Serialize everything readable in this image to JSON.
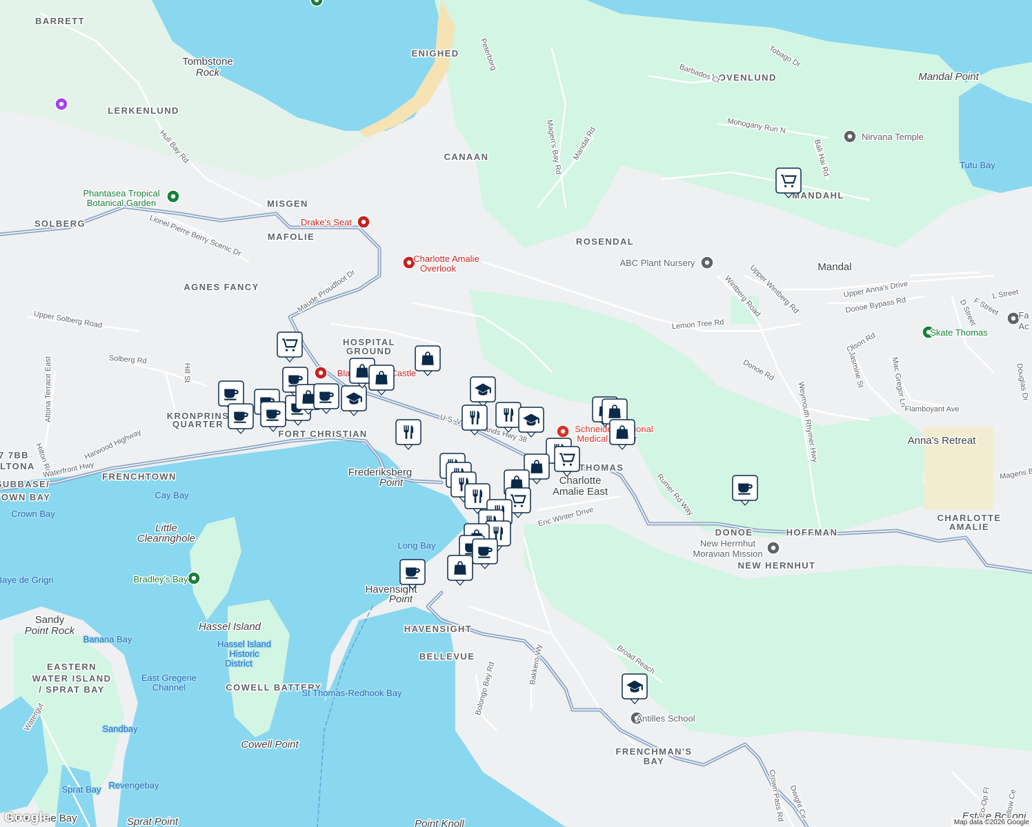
{
  "map": {
    "colors": {
      "land": "#eef0f2",
      "park": "#d3f5e3",
      "water": "#8ad7f0",
      "deep_water": "#5ec8ec",
      "beach": "#f5e3b3",
      "road": "#ffffff",
      "highway": "#8aa4c3",
      "marker": "#0b2a4a"
    },
    "labels": {
      "areas": [
        "BARRETT",
        "ENIGHED",
        "LOVENLUND",
        "LERKENLUND",
        "CANAAN",
        "MANDAHL",
        "MISGEN",
        "MAFOLIE",
        "SOLBERG",
        "ROSENDAL",
        "AGNES FANCY",
        "HOSPITAL",
        "GROUND",
        "KRONPRINS",
        "QUARTER",
        "FORT CHRISTIAN",
        "7 7BB",
        "ALTONA",
        "FRENCHTOWN",
        "SUBBASE/",
        "TOWN BAY",
        "THOMAS",
        "DONOE",
        "HOFFMAN",
        "NEW HERNHUT",
        "HAVENSIGHT",
        "BELLEVUE",
        "COWELL BATTERY",
        "EASTERN",
        "WATER ISLAND",
        "/ SPRAT BAY",
        "FRENCHMAN'S",
        "BAY",
        "CHARLOTTE",
        "AMALIE"
      ],
      "places": [
        "Tombstone",
        "Rock",
        "Mandal Point",
        "Mandal",
        "Anna's Retreat",
        "Charlotte",
        "Amalie East",
        "Frederiksberg",
        "Point",
        "Havensight",
        "Point ",
        "Little",
        "Clearinghole",
        "Hassel Island",
        "Sandy",
        "Point Rock",
        "Cowell Point",
        "Estate Bovoni",
        "Sprat Point",
        "Point Knoll",
        "Limestone Bay"
      ],
      "water": [
        "Tutu Bay",
        "Cay Bay",
        "Crown Bay",
        "Baye de Grigri",
        "Banana Bay",
        "Long Bay",
        "East Gregerie",
        "Channel",
        "Sandbay",
        "Revengebay",
        "Sprat Bay",
        "St Thomas-Redhook Bay",
        "Hassel Island",
        "Historic",
        "District"
      ],
      "pois": [
        "Phantasea Tropical",
        "Botanical Garden",
        "Drake's Seat",
        "Charlotte Amalie",
        "Overlook",
        "Blackbeard's Castle",
        "Nirvana Temple",
        "ABC Plant Nursery",
        "Skate Thomas",
        "Schneider Regional",
        "Medical Center",
        "New Herrnhut",
        "Moravian Mission",
        "Bradley's Bay",
        "Antilles School",
        "Fa",
        "Ac"
      ],
      "streets": [
        "Hull Bay Rd",
        "Lionel Pierre Berry Scenic Dr",
        "Maude Proudfoot Dr",
        "Upper Solberg Road",
        "Solberg Rd",
        "Hill St",
        "Altona Terrace East",
        "Harwood Highway",
        "Hilton Rd",
        "Waterfront Hwy",
        "U.S. Virgin Islands Hwy 38",
        "Peterborg",
        "Barbados Ct",
        "Tobago Dr",
        "Mohogany Run N",
        "Magen's Bay Rd",
        "Mandal Rd",
        "Bali Hai Rd",
        "Lemon Tree Rd",
        "Wintberg Road",
        "Upper Wintberg Rd",
        "Upper Anna's Drive",
        "Donoe Bypass Rd",
        "L Street",
        "F Street",
        "D Street",
        "Olson Rd",
        "Jasmine St",
        "Mac Gregor Ln",
        "Flamboyant Ave",
        "Douglas Dr",
        "Donoe Rd",
        "Weymouth Rhymer Hwy",
        "Rumer Rd Way",
        "Eric Winter Drive",
        "Broad Reach",
        "Bakkero Wy",
        "Bolongo Bay Rd",
        "Dwight Cir",
        "Crown Pass Rd",
        "Watergut",
        "Co-Op Fl",
        "Yellow Ce",
        "Magens Bay"
      ]
    },
    "marker_types": [
      "restaurant",
      "cafe",
      "shopping",
      "grocery",
      "school"
    ],
    "attribution": "Map data ©2026 Google",
    "logo": "Google"
  }
}
